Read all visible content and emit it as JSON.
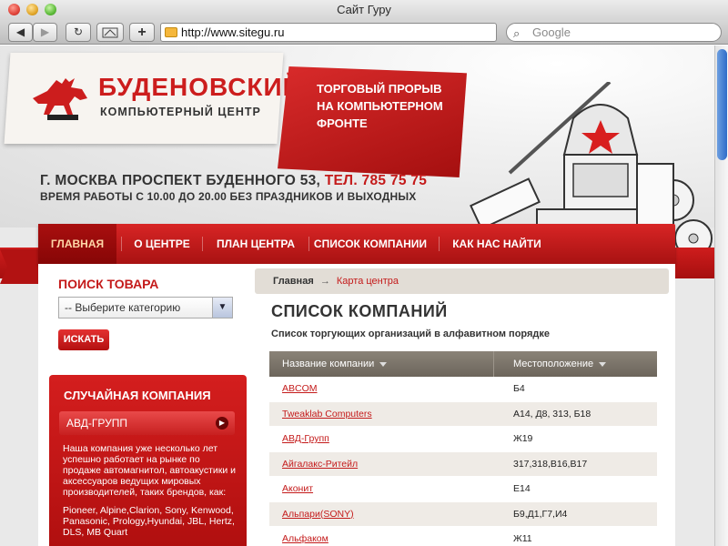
{
  "browser": {
    "window_title": "Сайт Гуру",
    "url": "http://www.sitegu.ru",
    "search_placeholder": "Google",
    "buttons": {
      "back": "◀",
      "forward": "▶",
      "reload": "↻",
      "add": "+"
    }
  },
  "header": {
    "logo_title": "БУДЕНОВСКИЙ",
    "logo_subtitle": "КОМПЬЮТЕРНЫЙ ЦЕНТР",
    "slogan": "ТОРГОВЫЙ ПРОРЫВ НА КОМПЬЮТЕРНОМ ФРОНТЕ",
    "address": "Г. МОСКВА ПРОСПЕКТ БУДЕННОГО 53,",
    "phone": "ТЕЛ. 785 75 75",
    "hours": "ВРЕМЯ РАБОТЫ С 10.00 ДО 20.00 БЕЗ ПРАЗДНИКОВ И ВЫХОДНЫХ"
  },
  "nav": {
    "items": [
      {
        "label": "ГЛАВНАЯ"
      },
      {
        "label": "О ЦЕНТРЕ"
      },
      {
        "label": "ПЛАН ЦЕНТРА"
      },
      {
        "label": "СПИСОК КОМПАНИИ"
      },
      {
        "label": "КАК НАС НАЙТИ"
      }
    ],
    "active": "ГЛАВНАЯ"
  },
  "sidebar": {
    "search_title": "ПОИСК ТОВАРА",
    "category_selected": "-- Выберите категорию",
    "search_button": "ИСКАТЬ",
    "random_title": "СЛУЧАЙНАЯ КОМПАНИЯ",
    "random_company": "АВД-ГРУПП",
    "random_desc": "Наша компания уже несколько лет успешно работает на рынке по продаже автомагнитол, автоакустики и аксессуаров ведущих мировых производителей, таких брендов, как:",
    "random_brands": "Pioneer, Alpine,Clarion, Sony, Kenwood, Panasonic, Prology,Hyundai, JBL, Hertz, DLS, MB Quart"
  },
  "content": {
    "breadcrumb": {
      "home": "Главная",
      "separator": "→",
      "current": "Карта центра"
    },
    "title": "СПИСОК КОМПАНИЙ",
    "subtitle": "Список торгующих организаций в алфавитном порядке",
    "table": {
      "headers": [
        "Название компании",
        "Местоположение"
      ],
      "rows": [
        {
          "name": "ABCOM",
          "location": "Б4"
        },
        {
          "name": "Tweaklab Computers",
          "location": "А14, Д8, 313, Б18"
        },
        {
          "name": "АВД-Групп",
          "location": "Ж19"
        },
        {
          "name": "Айгалакс-Ритейл",
          "location": "317,318,В16,В17"
        },
        {
          "name": "Аконит",
          "location": "Е14"
        },
        {
          "name": "Альпари(SONY)",
          "location": "Б9,Д1,Г7,И4"
        },
        {
          "name": "Альфаком",
          "location": "Ж11"
        }
      ]
    }
  },
  "colors": {
    "accent": "#c41a1a",
    "table_header": "#7a7368",
    "row_alt": "#efebe6"
  }
}
